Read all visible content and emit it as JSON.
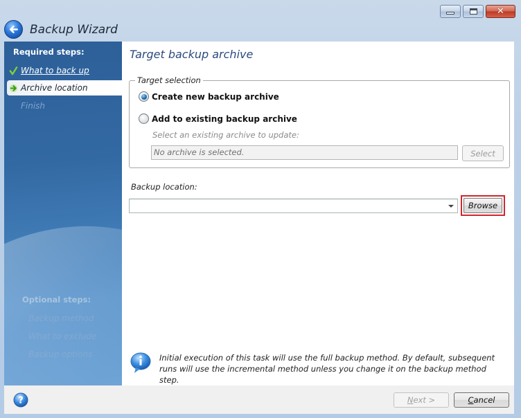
{
  "window": {
    "title": "Backup Wizard",
    "controls": {
      "minimize": "minimize",
      "maximize": "maximize",
      "close": "close"
    }
  },
  "sidebar": {
    "required_heading": "Required steps:",
    "required_steps": [
      {
        "label": "What to back up",
        "state": "completed",
        "icon": "checkmark-icon"
      },
      {
        "label": "Archive location",
        "state": "current",
        "icon": "arrow-right-icon"
      },
      {
        "label": "Finish",
        "state": "disabled"
      }
    ],
    "optional_heading": "Optional steps:",
    "optional_steps": [
      {
        "label": "Backup method"
      },
      {
        "label": "What to exclude"
      },
      {
        "label": "Backup options"
      }
    ]
  },
  "main": {
    "page_title": "Target backup archive",
    "target_selection": {
      "legend": "Target selection",
      "options": [
        {
          "label": "Create new backup archive",
          "checked": true
        },
        {
          "label": "Add to existing backup archive",
          "checked": false
        }
      ],
      "existing_label": "Select an existing archive to update:",
      "archive_field_value": "No archive is selected.",
      "select_button": "Select"
    },
    "backup_location": {
      "label": "Backup location:",
      "value": "",
      "browse_button": "Browse",
      "highlight_color": "#d0262e"
    },
    "info_text": "Initial execution of this task will use the full backup method. By default, subsequent runs will use the incremental method unless you change it on the backup method step."
  },
  "footer": {
    "next_prefix": "N",
    "next_rest": "ext >",
    "cancel_prefix": "C",
    "cancel_rest": "ancel"
  }
}
